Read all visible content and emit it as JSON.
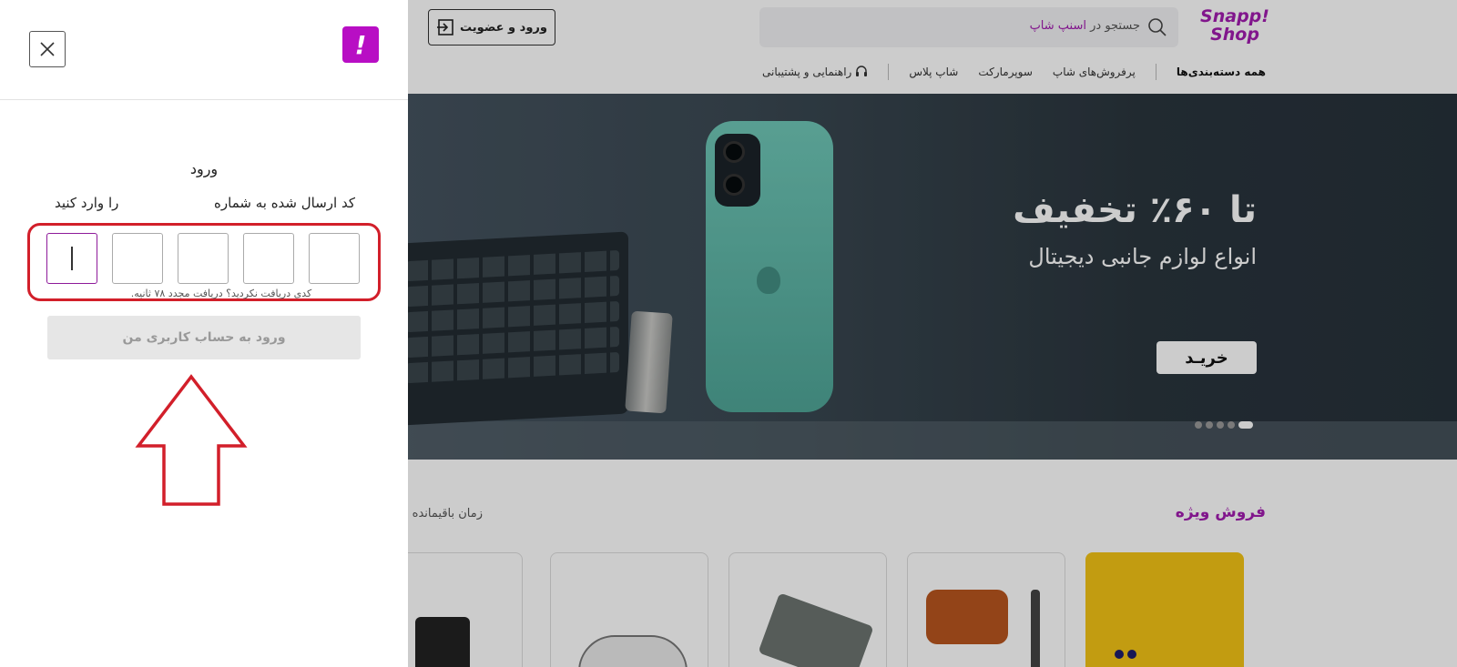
{
  "colors": {
    "brand": "#a21caf",
    "badge": "#b80ec4",
    "annotation": "#d21f2a"
  },
  "header": {
    "logo_line1": "Snapp!",
    "logo_line2": "Shop",
    "search_prefix": "جستجو در",
    "search_brand": "اسنپ شاپ",
    "login_label": "ورود و عضویت",
    "nav": {
      "all_categories": "همه دسته‌بندی‌ها",
      "bestsellers": "پرفروش‌های شاپ",
      "supermarket": "سوپرمارکت",
      "shop_plus": "شاپ پلاس",
      "help": "راهنمایی و پشتیبانی"
    }
  },
  "banner": {
    "title": "تا ۶۰٪ تخفیف",
    "subtitle": "انواع لوازم جانبی دیجیتال",
    "buy_label": "خریـد"
  },
  "special": {
    "title": "فروش ویژه",
    "remaining": "زمان باقیمانده"
  },
  "drawer": {
    "badge": "!",
    "login_title": "ورود",
    "code_sent_left": "را وارد کنید",
    "code_sent_right": "کد ارسال شده به شماره",
    "resend_text": "کدی دریافت نکردید؟ دریافت مجدد ۷۸ ثانیه.",
    "submit_label": "ورود به حساب کاربری من",
    "otp_fields": [
      "",
      "",
      "",
      "",
      ""
    ]
  }
}
